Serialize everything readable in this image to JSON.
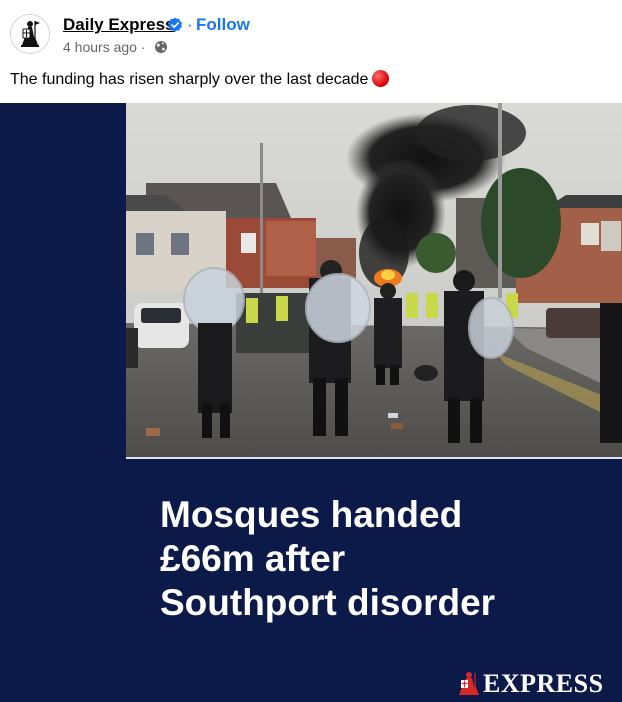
{
  "post": {
    "page_name": "Daily Express",
    "follow_label": "Follow",
    "separator": "·",
    "time_ago": "4 hours ago ·",
    "caption": "The funding has risen sharply over the last decade",
    "caption_emoji": "red-circle"
  },
  "media": {
    "headline_lines": [
      "Mosques handed",
      "£66m after",
      "Southport disorder"
    ],
    "brand_text": "EXPRESS",
    "photo_description_icon": "riot-police-scene",
    "background_color": "#0c1a4a"
  },
  "icons": {
    "verified": "verified-badge-icon",
    "privacy": "globe-icon",
    "avatar": "crusader-logo-icon"
  },
  "colors": {
    "link": "#1877f2",
    "muted": "#65676b",
    "text": "#050505"
  }
}
